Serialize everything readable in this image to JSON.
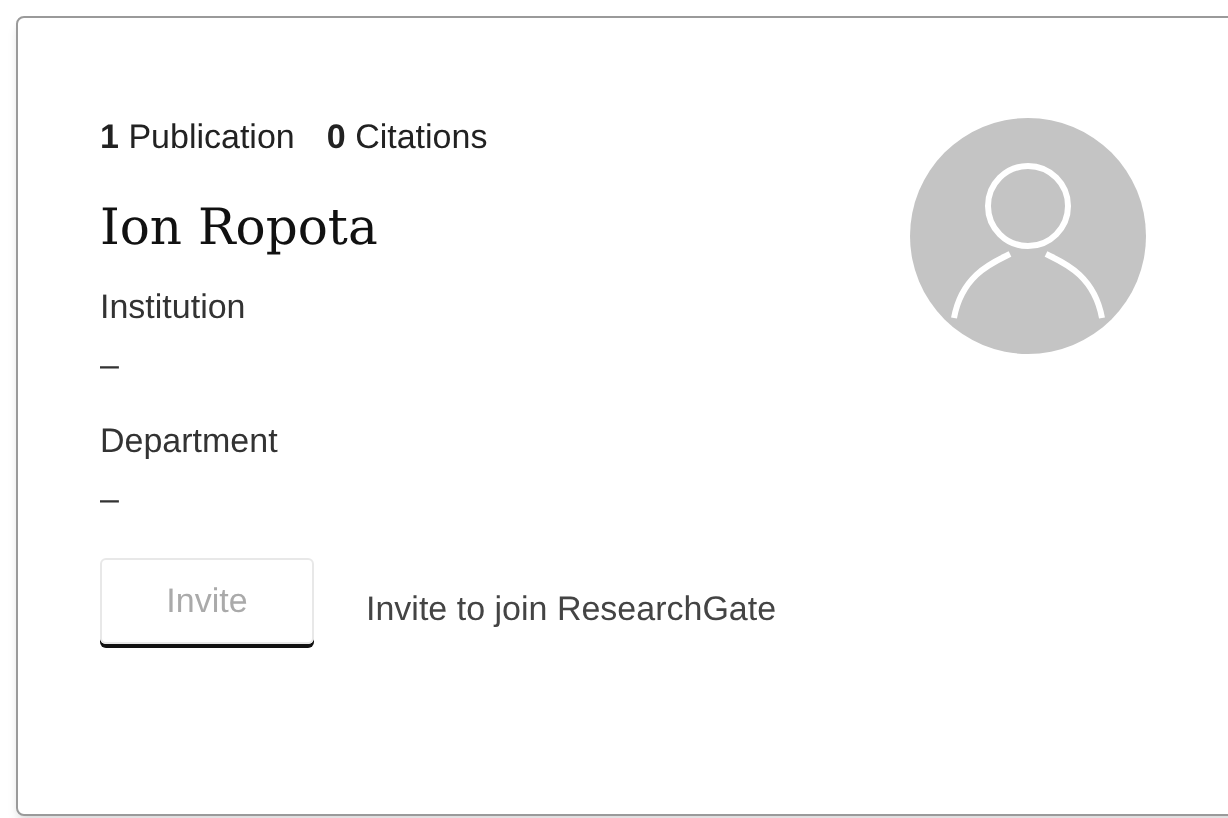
{
  "stats": [
    {
      "count": "1",
      "label": "Publication"
    },
    {
      "count": "0",
      "label": "Citations"
    }
  ],
  "name": "Ion Ropota",
  "fields": [
    {
      "label": "Institution",
      "value": "–"
    },
    {
      "label": "Department",
      "value": "–"
    }
  ],
  "invite": {
    "button": "Invite",
    "disabled": true,
    "text": "Invite to join ResearchGate"
  }
}
